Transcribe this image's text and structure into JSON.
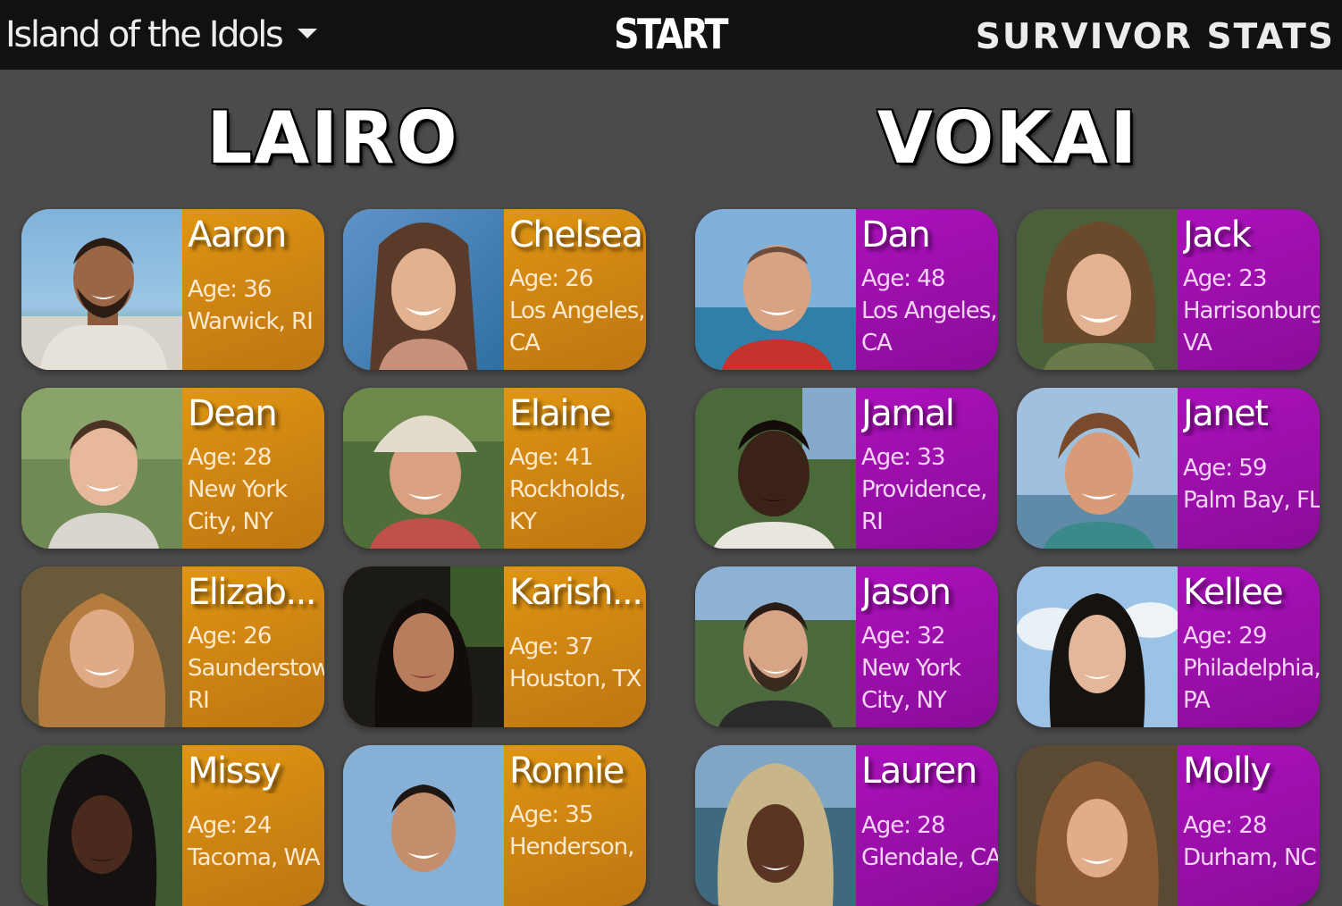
{
  "topbar": {
    "season": "Island of the Idols",
    "start_label": "START",
    "brand": "SURVIVOR STATS"
  },
  "colors": {
    "topbar": "#111111",
    "background": "#4b4b4b",
    "lairo_card": "#dd9412",
    "vokai_card": "#a40fb4"
  },
  "tribes": {
    "lairo": {
      "name": "LAIRO",
      "players": [
        {
          "name": "Aaron",
          "age": "Age: 36",
          "loc1": "Warwick, RI",
          "loc2": ""
        },
        {
          "name": "Chelsea",
          "age": "Age: 26",
          "loc1": "Los Angeles,",
          "loc2": "CA"
        },
        {
          "name": "Dean",
          "age": "Age: 28",
          "loc1": "New York",
          "loc2": "City, NY"
        },
        {
          "name": "Elaine",
          "age": "Age: 41",
          "loc1": "Rockholds,",
          "loc2": "KY"
        },
        {
          "name": "Elizab...",
          "age": "Age: 26",
          "loc1": "Saunderstown,",
          "loc2": "RI"
        },
        {
          "name": "Karish...",
          "age": "Age: 37",
          "loc1": "Houston, TX",
          "loc2": ""
        },
        {
          "name": "Missy",
          "age": "Age: 24",
          "loc1": "Tacoma, WA",
          "loc2": ""
        },
        {
          "name": "Ronnie",
          "age": "Age: 35",
          "loc1": "Henderson,",
          "loc2": ""
        }
      ]
    },
    "vokai": {
      "name": "VOKAI",
      "players": [
        {
          "name": "Dan",
          "age": "Age: 48",
          "loc1": "Los Angeles,",
          "loc2": "CA"
        },
        {
          "name": "Jack",
          "age": "Age: 23",
          "loc1": "Harrisonburg,",
          "loc2": "VA"
        },
        {
          "name": "Jamal",
          "age": "Age: 33",
          "loc1": "Providence,",
          "loc2": "RI"
        },
        {
          "name": "Janet",
          "age": "Age: 59",
          "loc1": "Palm Bay, FL",
          "loc2": ""
        },
        {
          "name": "Jason",
          "age": "Age: 32",
          "loc1": "New York",
          "loc2": "City, NY"
        },
        {
          "name": "Kellee",
          "age": "Age: 29",
          "loc1": "Philadelphia,",
          "loc2": "PA"
        },
        {
          "name": "Lauren",
          "age": "Age: 28",
          "loc1": "Glendale, CA",
          "loc2": ""
        },
        {
          "name": "Molly",
          "age": "Age: 28",
          "loc1": "Durham, NC",
          "loc2": ""
        }
      ]
    }
  }
}
